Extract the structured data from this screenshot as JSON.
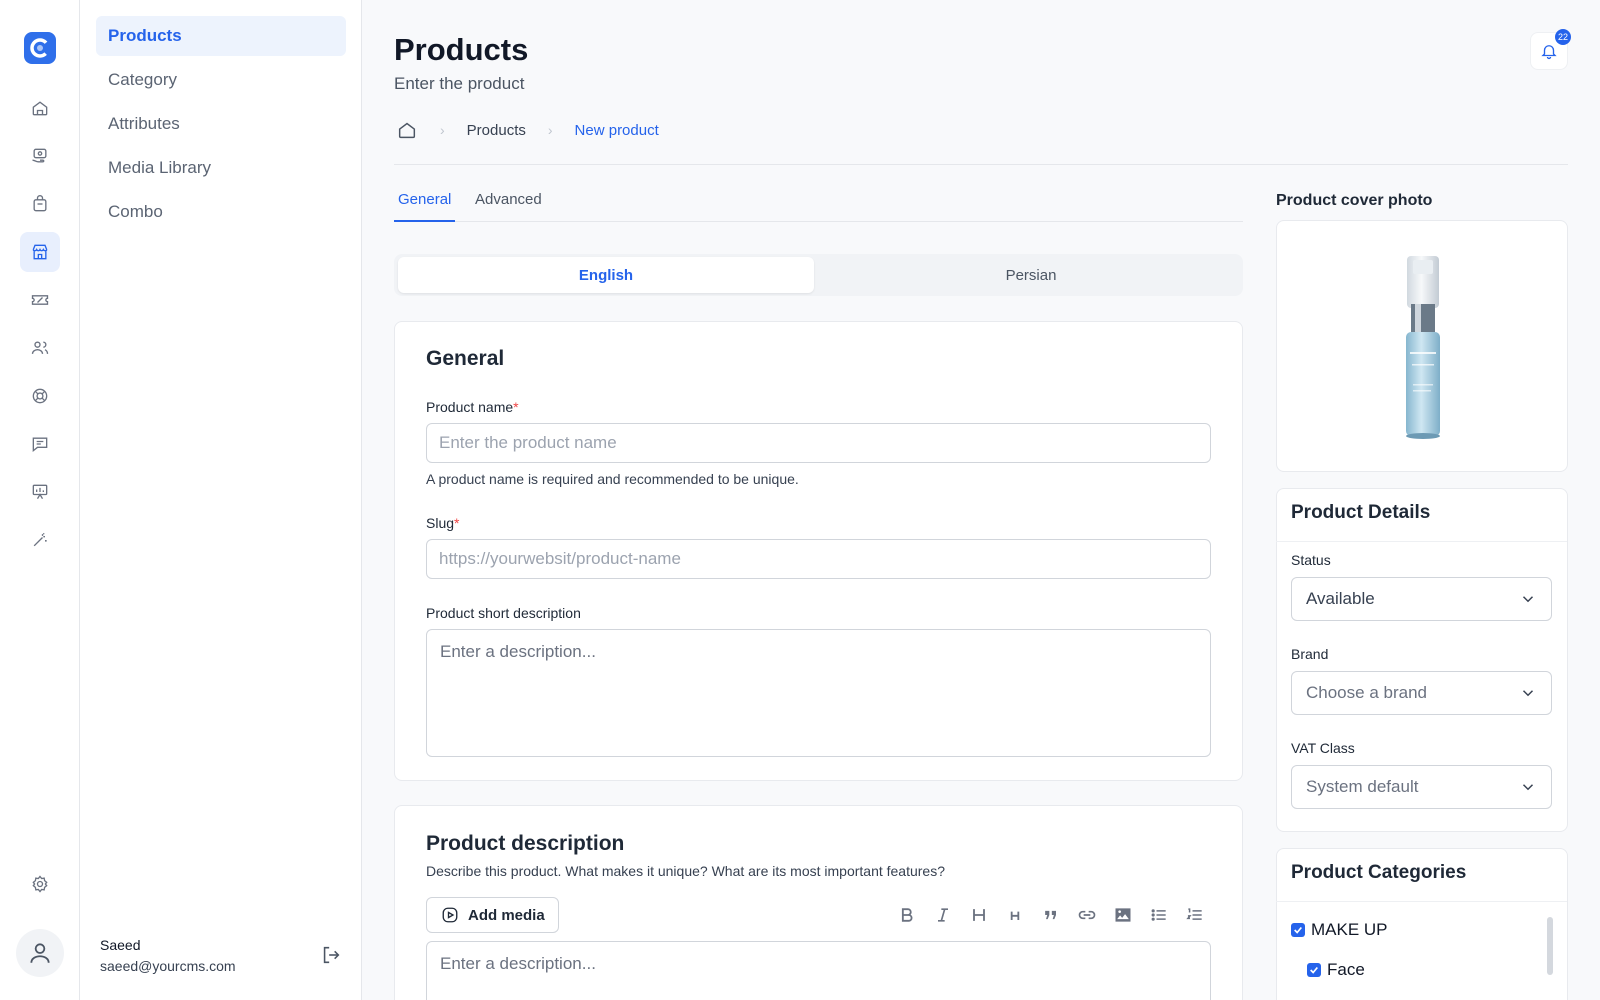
{
  "app": {
    "brand_color": "#2f6fea",
    "accent": "#2563eb"
  },
  "rail": {
    "items": [
      {
        "icon": "home-icon"
      },
      {
        "icon": "money-icon"
      },
      {
        "icon": "shopping-bag-icon"
      },
      {
        "icon": "store-icon",
        "active": true
      },
      {
        "icon": "ticket-icon"
      },
      {
        "icon": "users-icon"
      },
      {
        "icon": "support-icon"
      },
      {
        "icon": "chat-icon"
      },
      {
        "icon": "presentation-icon"
      },
      {
        "icon": "magic-wand-icon"
      }
    ],
    "settings_icon": "gear-icon",
    "avatar_icon": "user-icon"
  },
  "subnav": {
    "items": [
      {
        "label": "Products",
        "active": true
      },
      {
        "label": "Category"
      },
      {
        "label": "Attributes"
      },
      {
        "label": "Media Library"
      },
      {
        "label": "Combo"
      }
    ],
    "user": {
      "name": "Saeed",
      "email": "saeed@yourcms.com"
    }
  },
  "header": {
    "title": "Products",
    "subtitle": "Enter the product",
    "notifications": "22"
  },
  "breadcrumb": [
    "Products",
    "New product"
  ],
  "tabs": [
    "General",
    "Advanced"
  ],
  "languages": [
    "English",
    "Persian"
  ],
  "general": {
    "title": "General",
    "name_label": "Product name",
    "name_placeholder": "Enter the product name",
    "name_help": "A product name is required and recommended to be unique.",
    "slug_label": "Slug",
    "slug_placeholder": "https://yourwebsit/product-name",
    "short_desc_label": "Product short description",
    "short_desc_placeholder": "Enter a description..."
  },
  "description": {
    "title": "Product description",
    "subtitle": "Describe this product. What makes it unique? What are its most important features?",
    "add_media": "Add media",
    "placeholder": "Enter a description...",
    "toolbar": [
      "bold-icon",
      "italic-icon",
      "heading1-icon",
      "heading2-icon",
      "quote-icon",
      "link-icon",
      "image-icon",
      "bullet-list-icon",
      "numbered-list-icon"
    ]
  },
  "cover": {
    "label": "Product cover photo"
  },
  "details": {
    "title": "Product Details",
    "status_label": "Status",
    "status_value": "Available",
    "brand_label": "Brand",
    "brand_value": "Choose a brand",
    "vat_label": "VAT Class",
    "vat_value": "System default"
  },
  "categories": {
    "title": "Product Categories",
    "items": [
      {
        "label": "MAKE UP",
        "checked": true
      },
      {
        "label": "Face",
        "checked": true
      }
    ]
  }
}
